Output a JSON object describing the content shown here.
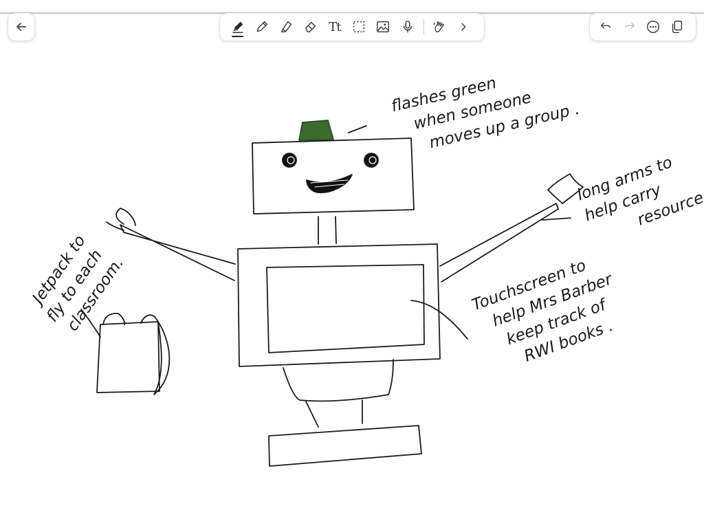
{
  "colors": {
    "ink": "#1b1b1b",
    "light_green": "#3d6a2f",
    "toolbar_bg": "#ffffff",
    "top_rule": "#b9c6d6"
  },
  "toolbar": {
    "back_icon": "arrow-left-icon",
    "tools": [
      {
        "name": "pen-tool",
        "icon": "pen-icon",
        "active": true
      },
      {
        "name": "pencil-tool",
        "icon": "pencil-icon",
        "active": false
      },
      {
        "name": "highlighter-tool",
        "icon": "highlighter-icon",
        "active": false
      },
      {
        "name": "eraser-tool",
        "icon": "eraser-icon",
        "active": false
      },
      {
        "name": "text-tool",
        "icon": "text-icon",
        "glyph": "Tt",
        "active": false
      },
      {
        "name": "selection-tool",
        "icon": "lasso-selection-icon",
        "active": false
      },
      {
        "name": "image-tool",
        "icon": "image-icon",
        "active": false
      },
      {
        "name": "audio-tool",
        "icon": "microphone-icon",
        "active": false
      },
      {
        "name": "touch-tool",
        "icon": "hand-draw-icon",
        "active": false
      }
    ],
    "more_tools_icon": "chevron-right-icon",
    "right": [
      "undo-icon",
      "redo-icon",
      "more-options-icon",
      "pages-icon"
    ]
  },
  "annotations": {
    "light": [
      "flashes green",
      "when someone",
      "moves up a group ."
    ],
    "arms": [
      "long arms to",
      "help carry",
      "resources"
    ],
    "jetpack": [
      "Jetpack to",
      "fly to each",
      "classroom."
    ],
    "screen": [
      "Touchscreen to",
      "help Mrs Barber",
      "keep track of",
      "RWI books ."
    ]
  }
}
